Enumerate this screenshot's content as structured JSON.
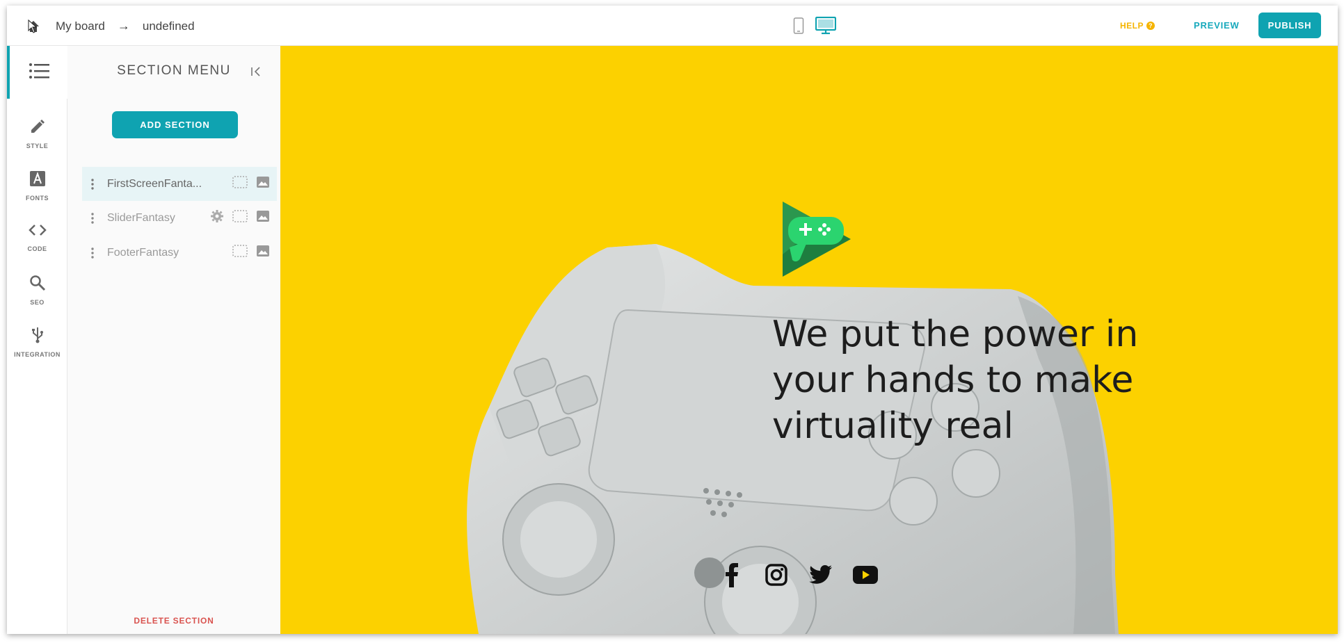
{
  "topbar": {
    "breadcrumb_home": "My board",
    "breadcrumb_separator": "→",
    "breadcrumb_page": "undefined",
    "help_label": "HELP",
    "preview_label": "PREVIEW",
    "publish_label": "PUBLISH",
    "device_selected": "desktop"
  },
  "rail": {
    "items": [
      {
        "label": "STYLE",
        "icon": "pencil-icon"
      },
      {
        "label": "FONTS",
        "icon": "font-icon"
      },
      {
        "label": "CODE",
        "icon": "code-icon"
      },
      {
        "label": "SEO",
        "icon": "search-icon"
      },
      {
        "label": "INTEGRATION",
        "icon": "usb-icon"
      }
    ]
  },
  "panel": {
    "title": "SECTION MENU",
    "add_section_label": "ADD SECTION",
    "sections": [
      {
        "name": "FirstScreenFanta...",
        "active": true,
        "has_settings": false
      },
      {
        "name": "SliderFantasy",
        "active": false,
        "has_settings": true
      },
      {
        "name": "FooterFantasy",
        "active": false,
        "has_settings": false
      }
    ],
    "delete_section_label": "DELETE SECTION"
  },
  "canvas": {
    "background": "#fcd100",
    "hero_text": "We put the power in your hands to make virtuality real",
    "socials": [
      "facebook-icon",
      "instagram-icon",
      "twitter-icon",
      "youtube-icon"
    ]
  },
  "colors": {
    "accent": "#0fa3b1",
    "help": "#f5b400",
    "danger": "#d9534f"
  }
}
